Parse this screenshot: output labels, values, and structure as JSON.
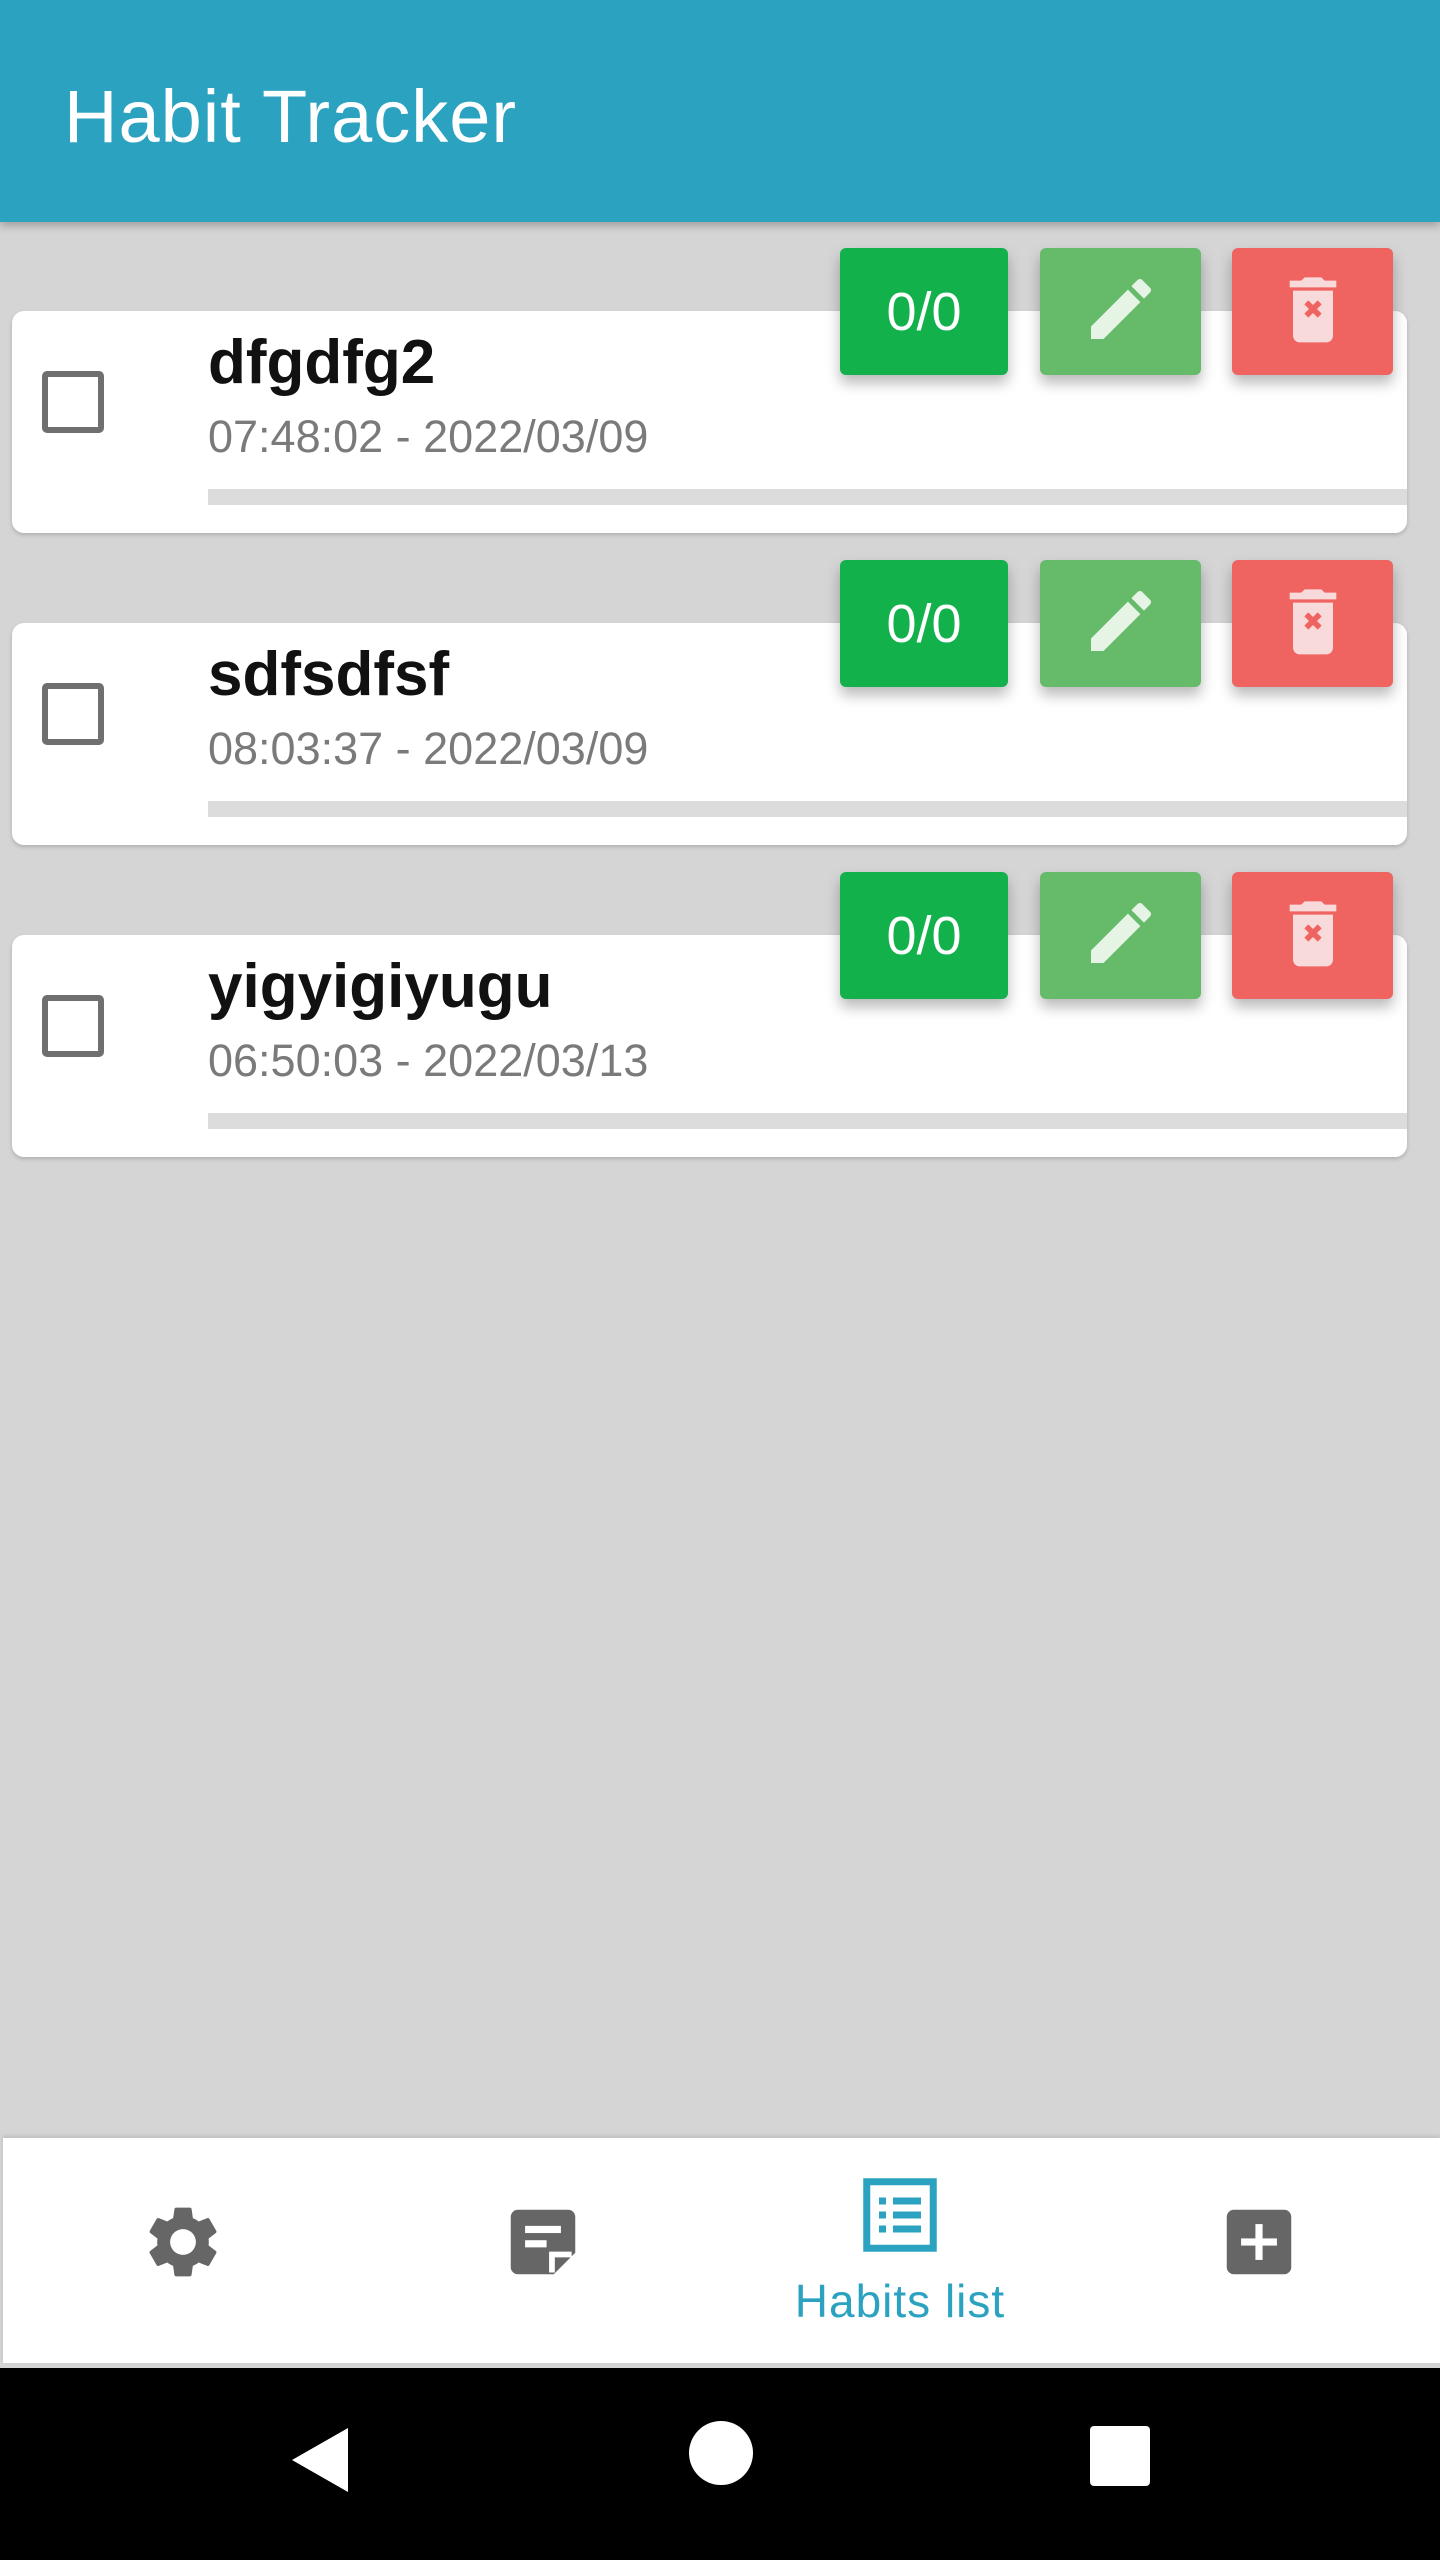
{
  "app": {
    "title": "Habit Tracker"
  },
  "colors": {
    "appbar": "#2ba3c0",
    "accent": "#2ba3c0",
    "count_button": "#12b14c",
    "edit_button": "#66bb6a",
    "delete_button": "#ef6360",
    "progress_track": "#dcdcdc"
  },
  "habits": [
    {
      "name": "dfgdfg2",
      "timestamp": "07:48:02 - 2022/03/09",
      "count_label": "0/0",
      "progress": 0,
      "checked": false
    },
    {
      "name": "sdfsdfsf",
      "timestamp": "08:03:37 - 2022/03/09",
      "count_label": "0/0",
      "progress": 0,
      "checked": false
    },
    {
      "name": "yigyigiyugu",
      "timestamp": "06:50:03 - 2022/03/13",
      "count_label": "0/0",
      "progress": 0,
      "checked": false
    }
  ],
  "bottom_nav": {
    "items": [
      {
        "icon": "gear-icon",
        "label": "",
        "active": false
      },
      {
        "icon": "note-icon",
        "label": "",
        "active": false
      },
      {
        "icon": "list-icon",
        "label": "Habits list",
        "active": true
      },
      {
        "icon": "add-box-icon",
        "label": "",
        "active": false
      }
    ]
  },
  "system_nav": {
    "buttons": [
      "back-icon",
      "home-icon",
      "recents-icon"
    ]
  }
}
